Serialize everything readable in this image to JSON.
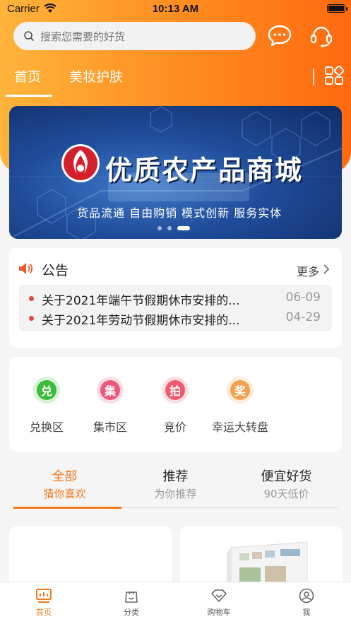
{
  "status_bar": {
    "carrier": "Carrier",
    "time": "10:13 AM"
  },
  "search": {
    "placeholder": "搜索您需要的好货"
  },
  "top_tabs": [
    {
      "label": "首页",
      "active": true
    },
    {
      "label": "美妆护肤",
      "active": false
    }
  ],
  "banner": {
    "title": "优质农产品商城",
    "subtitle": "货品流通 自由购销 模式创新 服务实体",
    "page_count": 3,
    "active_page": 3
  },
  "notice": {
    "title": "公告",
    "more": "更多",
    "items": [
      {
        "text": "关于2021年端午节假期休市安排的...",
        "date": "06-09"
      },
      {
        "text": "关于2021年劳动节假期休市安排的...",
        "date": "04-29"
      }
    ]
  },
  "entries": [
    {
      "glyph": "兑",
      "label": "兑换区",
      "color": "#3dbb3a"
    },
    {
      "glyph": "集",
      "label": "集市区",
      "color": "#f0557a"
    },
    {
      "glyph": "拍",
      "label": "竞价",
      "color": "#f05a6a"
    },
    {
      "glyph": "奖",
      "label": "幸运大转盘",
      "color": "#f5a14a"
    }
  ],
  "segments": [
    {
      "main": "全部",
      "sub": "猜你喜欢",
      "active": true
    },
    {
      "main": "推荐",
      "sub": "为你推荐",
      "active": false
    },
    {
      "main": "便宜好货",
      "sub": "90天低价",
      "active": false
    }
  ],
  "tabbar": [
    {
      "label": "首页",
      "icon": "home-monitor-icon",
      "active": true
    },
    {
      "label": "分类",
      "icon": "bag-icon",
      "active": false
    },
    {
      "label": "购物车",
      "icon": "diamond-icon",
      "active": false
    },
    {
      "label": "我",
      "icon": "person-icon",
      "active": false
    }
  ],
  "colors": {
    "accent": "#f07a1e",
    "header_from": "#ffb43a",
    "header_to": "#ff6a10"
  }
}
